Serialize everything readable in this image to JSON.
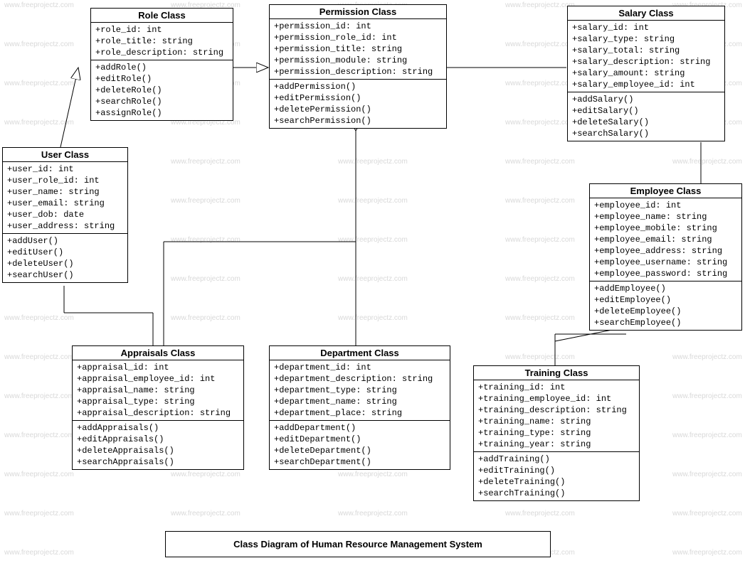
{
  "watermark_text": "www.freeprojectz.com",
  "caption": "Class Diagram of Human Resource Management System",
  "classes": {
    "role": {
      "title": "Role Class",
      "attrs": [
        "+role_id: int",
        "+role_title: string",
        "+role_description: string"
      ],
      "methods": [
        "+addRole()",
        "+editRole()",
        "+deleteRole()",
        "+searchRole()",
        "+assignRole()"
      ]
    },
    "permission": {
      "title": "Permission Class",
      "attrs": [
        "+permission_id: int",
        "+permission_role_id: int",
        "+permission_title: string",
        "+permission_module: string",
        "+permission_description: string"
      ],
      "methods": [
        "+addPermission()",
        "+editPermission()",
        "+deletePermission()",
        "+searchPermission()"
      ]
    },
    "salary": {
      "title": "Salary Class",
      "attrs": [
        "+salary_id: int",
        "+salary_type: string",
        "+salary_total: string",
        "+salary_description: string",
        "+salary_amount: string",
        "+salary_employee_id: int"
      ],
      "methods": [
        "+addSalary()",
        "+editSalary()",
        "+deleteSalary()",
        "+searchSalary()"
      ]
    },
    "user": {
      "title": "User Class",
      "attrs": [
        "+user_id: int",
        "+user_role_id: int",
        "+user_name: string",
        "+user_email: string",
        "+user_dob: date",
        "+user_address: string"
      ],
      "methods": [
        "+addUser()",
        "+editUser()",
        "+deleteUser()",
        "+searchUser()"
      ]
    },
    "employee": {
      "title": "Employee Class",
      "attrs": [
        "+employee_id: int",
        "+employee_name: string",
        "+employee_mobile: string",
        "+employee_email: string",
        "+employee_address: string",
        "+employee_username: string",
        "+employee_password: string"
      ],
      "methods": [
        "+addEmployee()",
        "+editEmployee()",
        "+deleteEmployee()",
        "+searchEmployee()"
      ]
    },
    "appraisals": {
      "title": "Appraisals Class",
      "attrs": [
        "+appraisal_id: int",
        "+appraisal_employee_id: int",
        "+appraisal_name: string",
        "+appraisal_type: string",
        "+appraisal_description: string"
      ],
      "methods": [
        "+addAppraisals()",
        "+editAppraisals()",
        "+deleteAppraisals()",
        "+searchAppraisals()"
      ]
    },
    "department": {
      "title": "Department Class",
      "attrs": [
        "+department_id: int",
        "+department_description: string",
        "+department_type: string",
        "+department_name: string",
        "+department_place: string"
      ],
      "methods": [
        "+addDepartment()",
        "+editDepartment()",
        "+deleteDepartment()",
        "+searchDepartment()"
      ]
    },
    "training": {
      "title": "Training Class",
      "attrs": [
        "+training_id: int",
        "+training_employee_id: int",
        "+training_description: string",
        "+training_name: string",
        "+training_type: string",
        "+training_year: string"
      ],
      "methods": [
        "+addTraining()",
        "+editTraining()",
        "+deleteTraining()",
        "+searchTraining()"
      ]
    }
  }
}
